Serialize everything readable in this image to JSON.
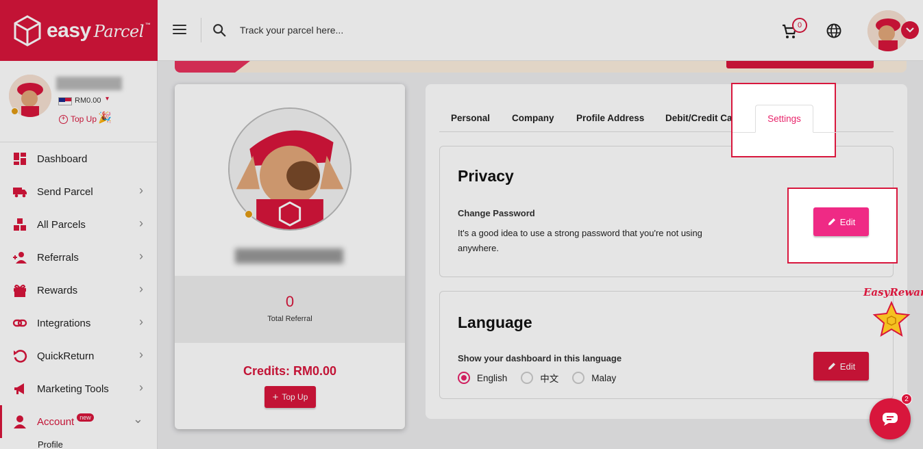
{
  "brand": {
    "name": "easy",
    "script": "Parcel",
    "tm": "™"
  },
  "header": {
    "search_placeholder": "Track your parcel here...",
    "cart_count": "0"
  },
  "sidebar": {
    "balance": "RM0.00",
    "topup": "Top Up",
    "items": [
      {
        "label": "Dashboard",
        "icon": "dashboard-icon"
      },
      {
        "label": "Send Parcel",
        "icon": "truck-icon"
      },
      {
        "label": "All Parcels",
        "icon": "boxes-icon"
      },
      {
        "label": "Referrals",
        "icon": "user-plus-icon"
      },
      {
        "label": "Rewards",
        "icon": "gift-icon"
      },
      {
        "label": "Integrations",
        "icon": "link-icon"
      },
      {
        "label": "QuickReturn",
        "icon": "return-icon"
      },
      {
        "label": "Marketing Tools",
        "icon": "megaphone-icon"
      },
      {
        "label": "Account",
        "icon": "user-icon",
        "badge": "new"
      }
    ],
    "sub_item": "Profile"
  },
  "profile": {
    "referral_count": "0",
    "referral_label": "Total Referral",
    "credits": "Credits: RM0.00",
    "topup": "Top Up"
  },
  "tabs": [
    "Personal",
    "Company",
    "Profile Address",
    "Debit/Credit Card",
    "Settings"
  ],
  "privacy": {
    "title": "Privacy",
    "label": "Change Password",
    "description": "It's a good idea to use a strong password that you're not using anywhere.",
    "edit": "Edit"
  },
  "language": {
    "title": "Language",
    "label": "Show your dashboard in this language",
    "options": [
      "English",
      "中文",
      "Malay"
    ],
    "selected": "English",
    "edit": "Edit"
  },
  "reward_badge": "EasyReward",
  "chat_badge": "2",
  "colors": {
    "brand": "#d8163c",
    "accent": "#e8236a"
  }
}
